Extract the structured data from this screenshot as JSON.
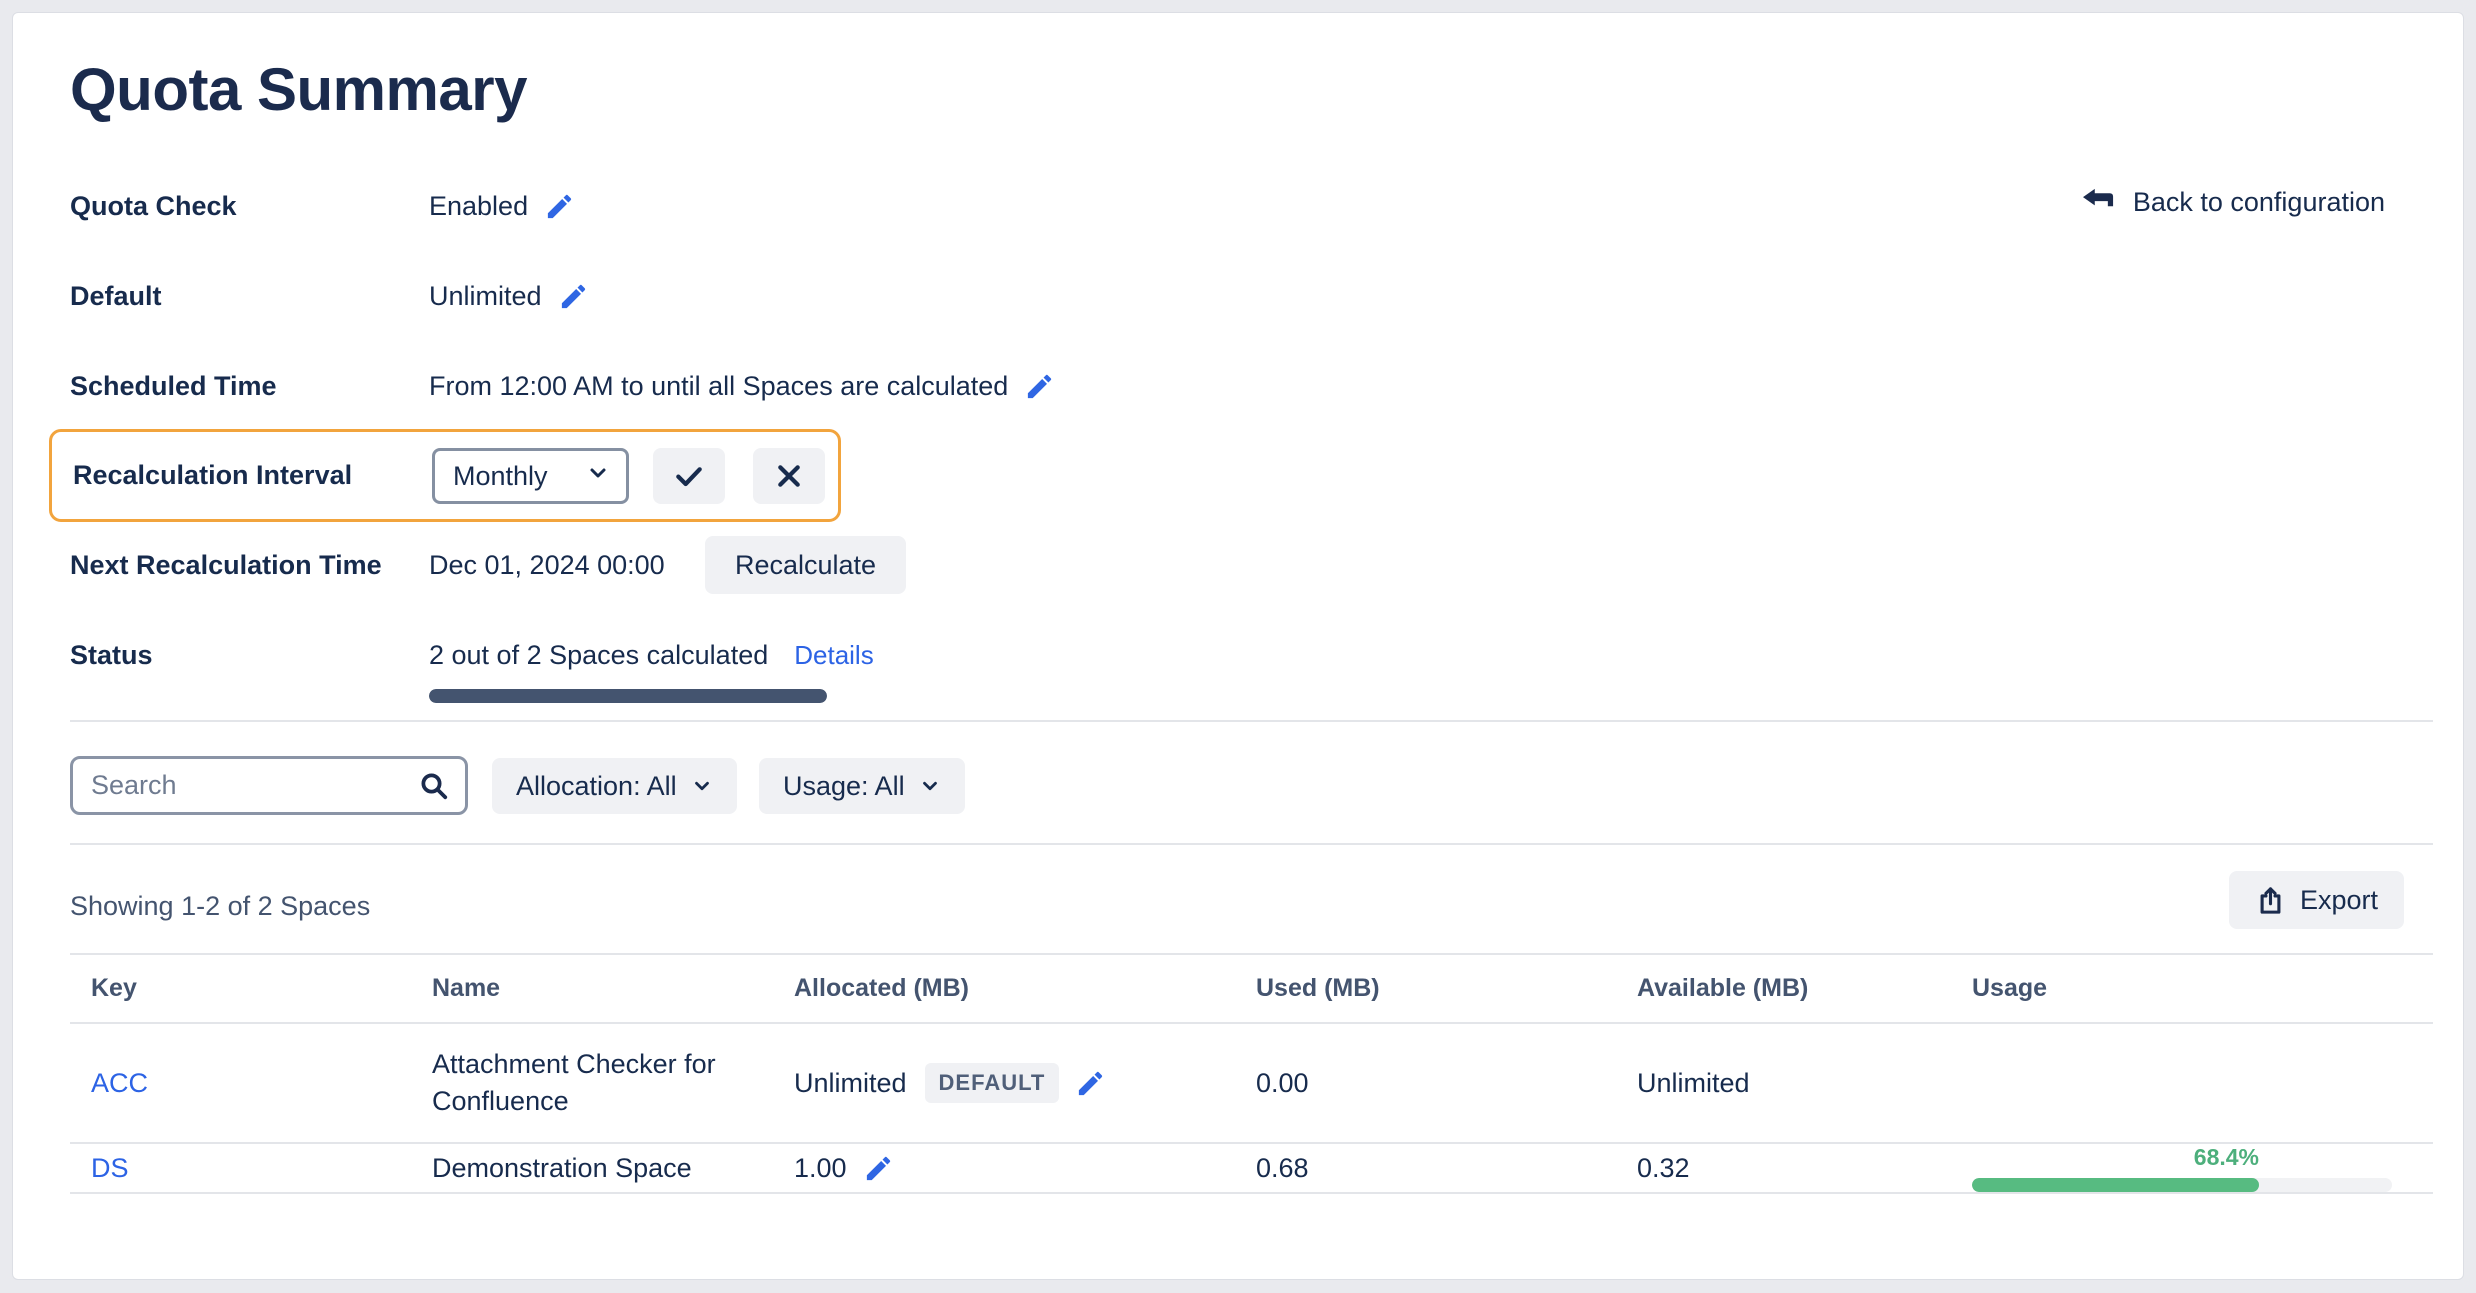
{
  "page": {
    "title": "Quota Summary",
    "back_link": "Back to configuration"
  },
  "colors": {
    "accent_blue": "#2c63e5",
    "highlight_orange": "#f2a43d",
    "status_bar": "#44546f",
    "usage_green": "#57bb81",
    "usage_green_text": "#4daf7c",
    "text_navy": "#172b4d",
    "button_gray": "#f0f1f4"
  },
  "fields": [
    {
      "label": "Quota Check",
      "value": "Enabled"
    },
    {
      "label": "Default",
      "value": "Unlimited"
    },
    {
      "label": "Scheduled Time",
      "value": "From 12:00 AM to until all Spaces are calculated"
    }
  ],
  "recalc_interval": {
    "label": "Recalculation Interval",
    "selected": "Monthly"
  },
  "next_recalc": {
    "label": "Next Recalculation Time",
    "value": "Dec 01, 2024 00:00",
    "button": "Recalculate"
  },
  "status": {
    "label": "Status",
    "value": "2 out of 2 Spaces calculated",
    "details_label": "Details",
    "progress_percent": 100
  },
  "filters": {
    "search_placeholder": "Search",
    "allocation": "Allocation: All",
    "usage": "Usage: All"
  },
  "list": {
    "showing": "Showing 1-2 of 2 Spaces",
    "export_label": "Export"
  },
  "table": {
    "columns": [
      "Key",
      "Name",
      "Allocated  (MB)",
      "Used  (MB)",
      "Available  (MB)",
      "Usage"
    ],
    "rows": [
      {
        "key": "ACC",
        "name": "Attachment Checker for Confluence",
        "allocated": "Unlimited",
        "badge": "DEFAULT",
        "used": "0.00",
        "available": "Unlimited",
        "usage_percent": null,
        "usage_label": ""
      },
      {
        "key": "DS",
        "name": "Demonstration Space",
        "allocated": "1.00",
        "badge": null,
        "used": "0.68",
        "available": "0.32",
        "usage_percent": 68.4,
        "usage_label": "68.4%"
      }
    ]
  }
}
